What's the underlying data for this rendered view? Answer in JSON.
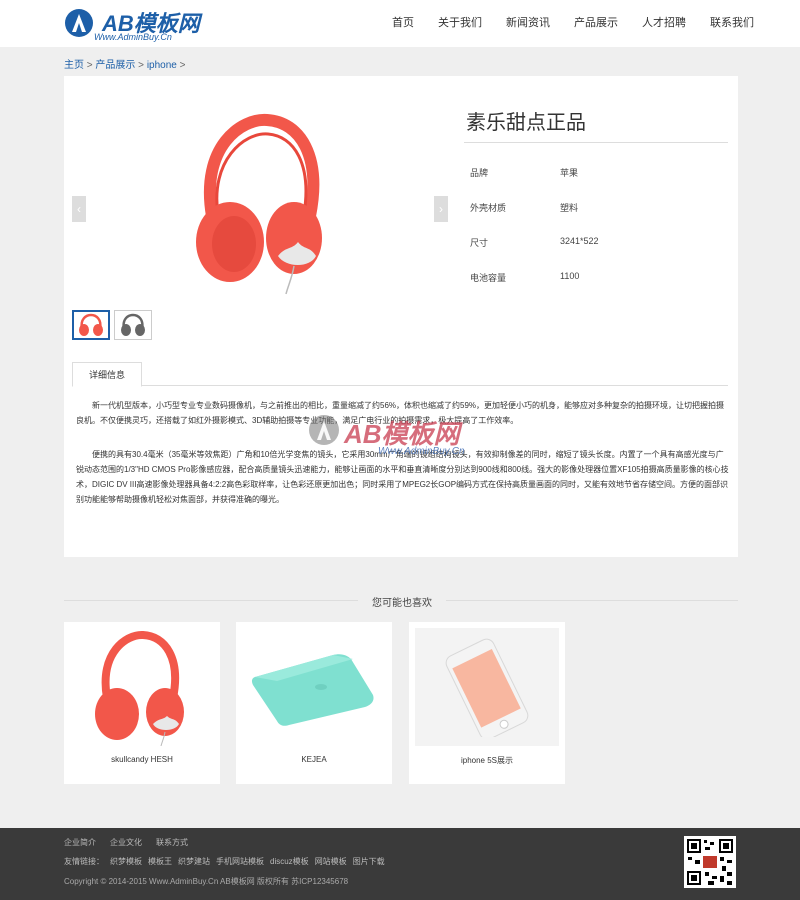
{
  "header": {
    "logo_text": "AB模板网",
    "logo_sub": "Www.AdminBuy.Cn",
    "nav": [
      "首页",
      "关于我们",
      "新闻资讯",
      "产品展示",
      "人才招聘",
      "联系我们"
    ]
  },
  "breadcrumb": {
    "home": "主页",
    "sep1": " > ",
    "category": "产品展示",
    "sep2": " > ",
    "current": "iphone",
    "sep3": " >"
  },
  "product": {
    "title": "素乐甜点正品",
    "attributes": [
      {
        "key": "品牌",
        "value": "苹果"
      },
      {
        "key": "外壳材质",
        "value": "塑料"
      },
      {
        "key": "尺寸",
        "value": "3241*522"
      },
      {
        "key": "电池容量",
        "value": "1100"
      }
    ],
    "arrow_left": "‹",
    "arrow_right": "›",
    "tab_label": "详细信息",
    "description": [
      "新一代机型版本，小巧型专业专业数码摄像机，与之前推出的相比，重量缩减了约56%，体积也缩减了约59%，更加轻便小巧的机身，能够应对多种复杂的拍摄环境，让切把握拍摄良机。不仅便携灵巧，还搭载了如红外摄影模式、3D辅助拍摄等专业功能，满足广电行业的拍摄需求，极大提高了工作效率。",
      "便携的具有30.4毫米（35毫米等效焦距）广角和10倍光学变焦的镜头，它采用30mm广角端的镜组结构镜头，有效抑制像差的同时，缩短了镜头长度。内置了一个具有高感光度与广锐动态范围的1/3\"HD CMOS Pro影像感应器，配合高质量镜头迅速能力，能够让画面的水平和垂直清晰度分别达到900线和800线。强大的影像处理器位置XF105拍摄高质量影像的核心技术，DIGIC DV III高速影像处理器具备4:2:2高色彩取样率，让色彩还原更加出色；同时采用了MPEG2长GOP编码方式在保持高质量画面的同时，又能有效地节省存储空间。方便的面部识别功能能够帮助摄像机轻松对焦面部，并获得准确的曝光。"
    ]
  },
  "watermark": {
    "text": "AB模板网",
    "sub": "Www.AdminBuy.Cn"
  },
  "related": {
    "title": "您可能也喜欢",
    "items": [
      {
        "label": "skullcandy HESH"
      },
      {
        "label": "KEJEA"
      },
      {
        "label": "iphone 5S展示"
      }
    ]
  },
  "footer": {
    "links": [
      "企业简介",
      "企业文化",
      "联系方式"
    ],
    "friends_label": "友情链接：",
    "friends": [
      "织梦模板",
      "模板王",
      "织梦建站",
      "手机网站模板",
      "discuz模板",
      "网站模板",
      "图片下载"
    ],
    "copyright": "Copyright © 2014-2015 Www.AdminBuy.Cn AB模板网 版权所有   苏ICP12345678"
  },
  "colors": {
    "brand": "#1d5fa8",
    "headphone": "#f2574a",
    "case": "#7fe0d0",
    "footer_bg": "#3a3a3a"
  }
}
